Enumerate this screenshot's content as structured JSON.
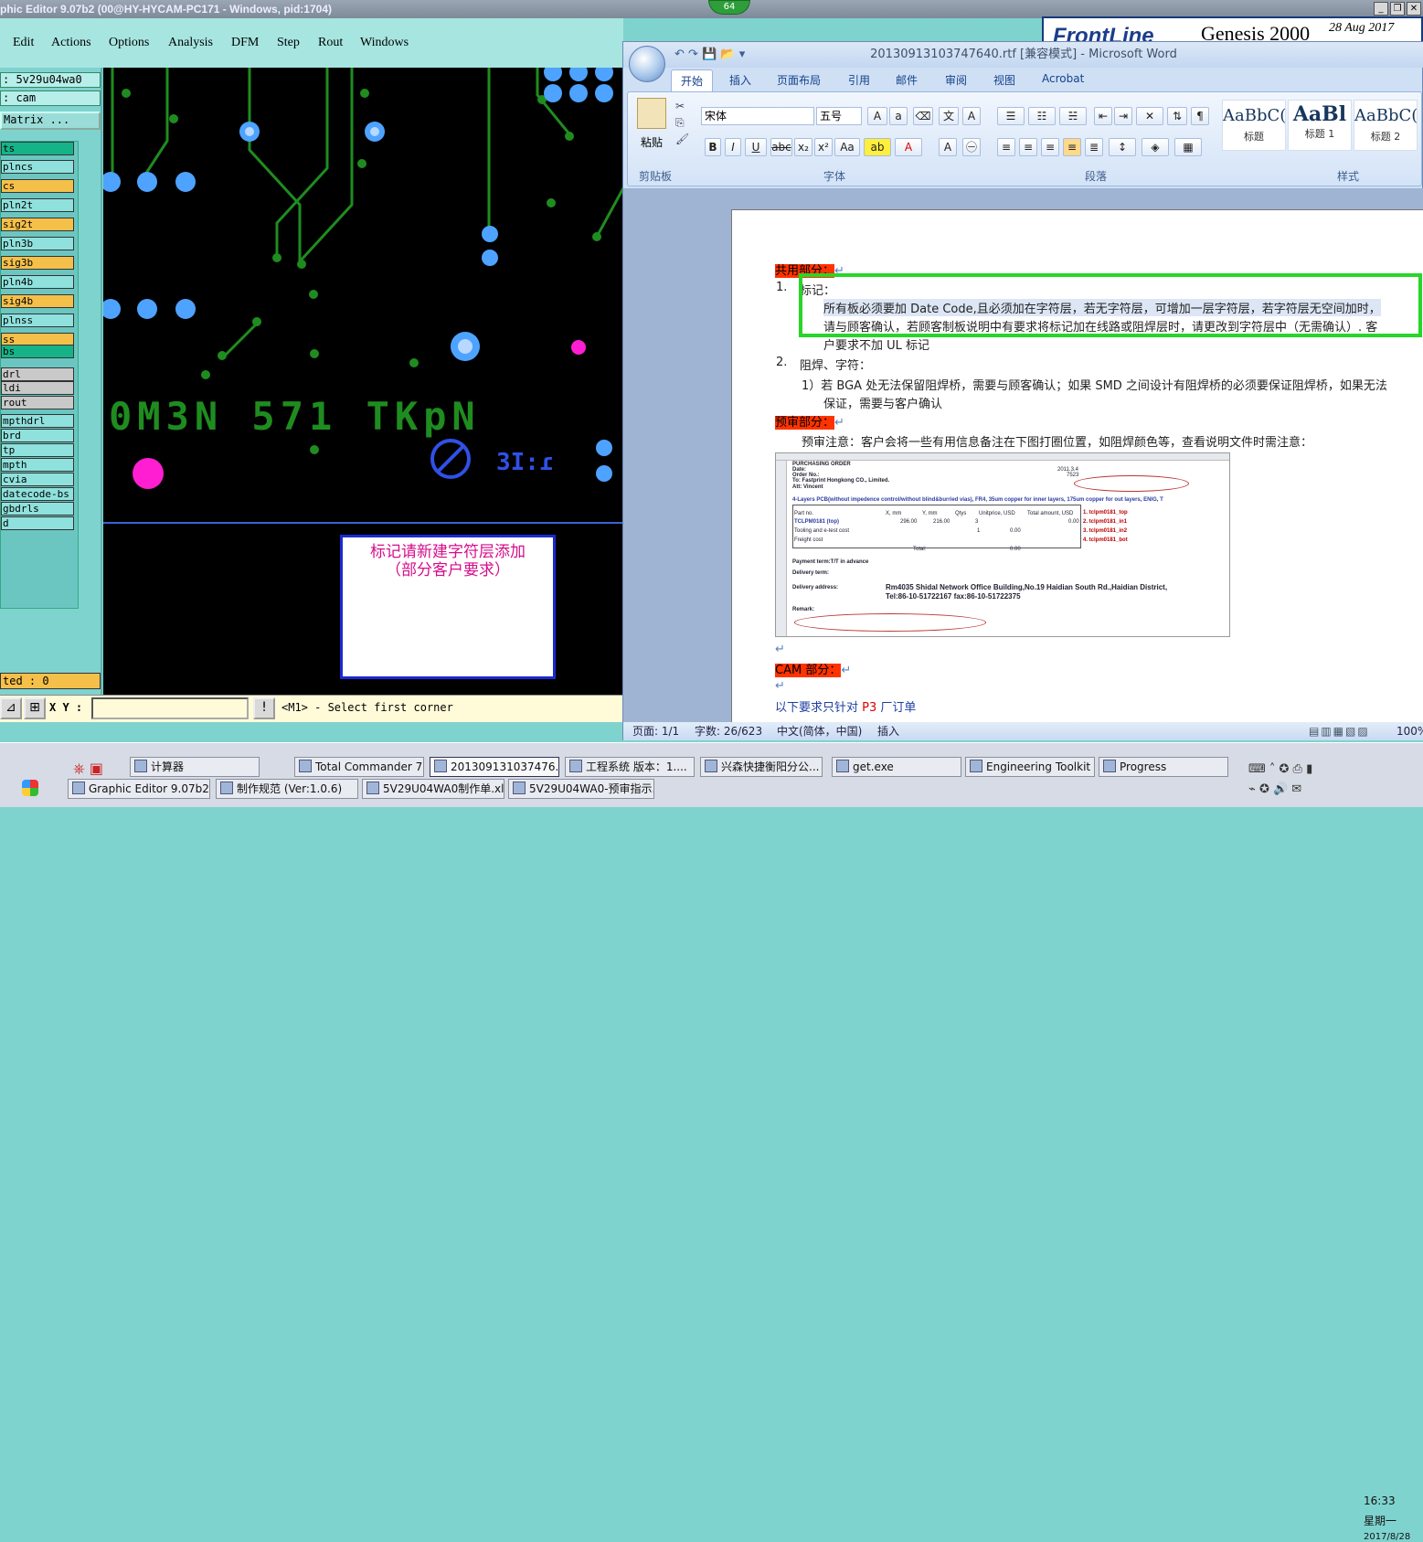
{
  "genesis": {
    "title": "phic Editor 9.07b2 (00@HY-HYCAM-PC171 - Windows, pid:1704)",
    "badge": "64",
    "menu": [
      "Edit",
      "Actions",
      "Options",
      "Analysis",
      "DFM",
      "Step",
      "Rout",
      "Windows"
    ],
    "job": ":  5v29u04wa0",
    "step": ":  cam",
    "matrix_label": "Matrix ...",
    "layers": [
      {
        "name": "ts",
        "color": "#16b389"
      },
      {
        "name": "plncs",
        "color": "#8fe1dd"
      },
      {
        "name": "cs",
        "color": "#f5c04a"
      },
      {
        "name": "pln2t",
        "color": "#8fe1dd"
      },
      {
        "name": "sig2t",
        "color": "#f5c04a"
      },
      {
        "name": "pln3b",
        "color": "#8fe1dd"
      },
      {
        "name": "sig3b",
        "color": "#f5c04a"
      },
      {
        "name": "pln4b",
        "color": "#8fe1dd"
      },
      {
        "name": "sig4b",
        "color": "#f5c04a"
      },
      {
        "name": "plnss",
        "color": "#8fe1dd"
      },
      {
        "name": "ss",
        "color": "#f5c04a"
      },
      {
        "name": "bs",
        "color": "#16b389"
      },
      {
        "name": "drl",
        "color": "#c9c9c9"
      },
      {
        "name": "ldi",
        "color": "#c9c9c9"
      },
      {
        "name": "rout",
        "color": "#c9c9c9"
      },
      {
        "name": "mpthdrl",
        "color": "#8fe1dd"
      },
      {
        "name": "brd",
        "color": "#8fe1dd"
      },
      {
        "name": "tp",
        "color": "#8fe1dd"
      },
      {
        "name": "mpth",
        "color": "#8fe1dd"
      },
      {
        "name": "cvia",
        "color": "#8fe1dd"
      },
      {
        "name": "datecode-bs",
        "color": "#8fe1dd"
      },
      {
        "name": "gbdrls",
        "color": "#8fe1dd"
      },
      {
        "name": "d",
        "color": "#8fe1dd"
      }
    ],
    "selected": "ted : 0",
    "xy_label": "X Y :",
    "xy_value": "",
    "message": "<M1> - Select first corner",
    "canvas_text": "0M3N 571 TKpN",
    "note_line1": "标记请新建字符层添加",
    "note_line2": "（部分客户要求）"
  },
  "frontline": {
    "logo": "FrontLine",
    "product": "Genesis 2000",
    "date": "28 Aug 2017"
  },
  "word": {
    "title": "20130913103747640.rtf [兼容模式] - Microsoft Word",
    "tabs": [
      "开始",
      "插入",
      "页面布局",
      "引用",
      "邮件",
      "审阅",
      "视图",
      "Acrobat"
    ],
    "font_name": "宋体",
    "font_size": "五号",
    "groups": {
      "clipboard": "剪贴板",
      "font": "字体",
      "paragraph": "段落",
      "styles": "样式"
    },
    "paste_label": "粘贴",
    "styles": [
      {
        "preview": "AaBbC(",
        "name": "标题"
      },
      {
        "preview": "AaBl",
        "name": "标题 1"
      },
      {
        "preview": "AaBbC(",
        "name": "标题 2"
      }
    ],
    "doc": {
      "h1": "共用部分：",
      "item1_num": "1.",
      "item1_title": "标记：",
      "item1_line1": "所有板必须要加 Date Code,且必须加在字符层，若无字符层，可增加一层字符层，若字符层无空间加时，",
      "item1_line2": "请与顾客确认，若顾客制板说明中有要求将标记加在线路或阻焊层时，请更改到字符层中（无需确认）. 客",
      "item1_line3": "户要求不加 UL 标记",
      "item2_num": "2.",
      "item2_title": "阻焊、字符：",
      "item2_line1": "1）若 BGA 处无法保留阻焊桥，需要与顾客确认；如果 SMD 之间设计有阻焊桥的必须要保证阻焊桥，如果无法",
      "item2_line2": "保证，需要与客户确认",
      "h2": "预审部分：",
      "pre_note": "预审注意：客户会将一些有用信息备注在下图打圈位置，如阻焊颜色等，查看说明文件时需注意：",
      "h3": "CAM 部分：",
      "cam_line_prefix": "以下要求只针对 ",
      "cam_line_code": "P3",
      "cam_line_suffix": " 厂订单"
    },
    "sheet": {
      "po": "PURCHASING ORDER",
      "date_label": "Date:",
      "date": "2011.3.4",
      "order_label": "Order No.:",
      "order": "7523",
      "to": "To: Fastprint Hongkong CO., Limited.",
      "attn": "Att: Vincent",
      "spec": "4-Layers PCB(without impedence control/without blind&burried vias), FR4, 35um copper for inner layers, 175um copper for out layers, ENIG, T",
      "col_part": "Part no.",
      "col_x": "X, mm",
      "col_y": "Y, mm",
      "col_qty": "Qtys",
      "col_unit": "Unitprice, USD",
      "col_total": "Total amount, USD",
      "row_part": "TCLPM0181 (top)",
      "row_x": "296.00",
      "row_y": "216.00",
      "row_qty": "3",
      "row_amt": "0.00",
      "tooling": "Tooling and e-test cost",
      "tooling_qty": "1",
      "tooling_amt": "0.00",
      "freight": "Freight cost",
      "total_label": "Total:",
      "total": "0.00",
      "files": [
        "1. tclpm0181_top",
        "2. tclpm0181_in1",
        "3. tclpm0181_in2",
        "4. tclpm0181_bot"
      ],
      "payment": "Payment term:T/T in advance",
      "delivery_term": "Delivery term:",
      "delivery_addr": "Delivery address:",
      "addr": "Rm4035 Shidal Network Office Building,No.19 Haidian South Rd.,Haidian District,",
      "tel": "Tel:86-10-51722167 fax:86-10-51722375",
      "remark": "Remark:"
    },
    "status": {
      "page": "页面: 1/1",
      "words": "字数: 26/623",
      "lang": "中文(简体，中国)",
      "mode": "插入",
      "zoom": "100%"
    }
  },
  "taskbar": {
    "row1": [
      "计算器",
      "Total Commander 7.0...",
      "201309131037476...",
      "工程系统  版本：1....",
      "兴森快捷衡阳分公...",
      "get.exe",
      "Engineering Toolkit 9....",
      "Progress"
    ],
    "row2": [
      "Graphic Editor 9.07b2 (0...",
      "制作规范 (Ver:1.0.6)",
      "5V29U04WA0制作单.xls...",
      "5V29U04WA0-预审指示..."
    ],
    "time": "16:33",
    "day": "星期一",
    "date": "2017/8/28"
  },
  "colors": {
    "accent_red": "#ff3300",
    "green_box": "#27d629",
    "canvas_green": "#1f8c1f",
    "pad_blue": "#4da3ff",
    "pad_magenta": "#ff1ed1"
  }
}
